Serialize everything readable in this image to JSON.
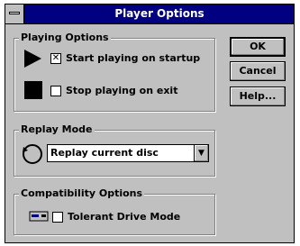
{
  "window": {
    "title": "Player Options"
  },
  "buttons": {
    "ok": "OK",
    "cancel": "Cancel",
    "help": "Help..."
  },
  "playing_options": {
    "label": "Playing Options",
    "start_on_startup": {
      "label": "Start playing on startup",
      "checked": true
    },
    "stop_on_exit": {
      "label": "Stop playing on exit",
      "checked": false
    }
  },
  "replay_mode": {
    "label": "Replay Mode",
    "selected": "Replay current disc"
  },
  "compatibility": {
    "label": "Compatibility Options",
    "tolerant_mode": {
      "label": "Tolerant Drive Mode",
      "checked": false
    }
  },
  "icons": {
    "play": "play-icon",
    "stop": "stop-icon",
    "replay": "replay-loop-icon",
    "drive": "drive-icon",
    "system_menu": "system-menu-icon",
    "dropdown": "chevron-down-icon"
  },
  "colors": {
    "titlebar": "#000080",
    "dialog_face": "#c0c0c0"
  }
}
